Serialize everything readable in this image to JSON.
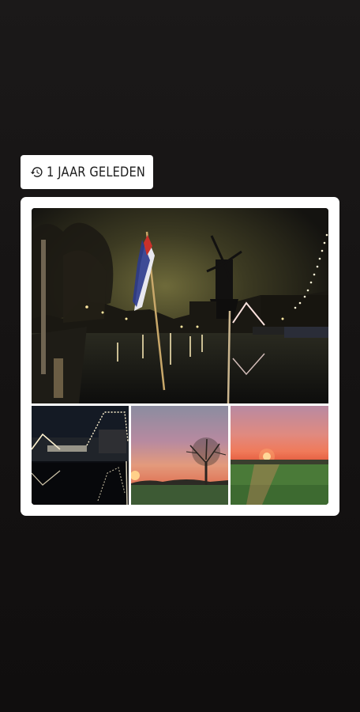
{
  "memory": {
    "label": "1 JAAR GELEDEN",
    "icon": "history-icon"
  },
  "collage": {
    "photos": [
      {
        "name": "photo-canal-windmill-night",
        "position": "main"
      },
      {
        "name": "photo-boat-lights-night",
        "position": "bottom-left"
      },
      {
        "name": "photo-tree-sunset",
        "position": "bottom-middle"
      },
      {
        "name": "photo-field-sunset",
        "position": "bottom-right"
      }
    ]
  },
  "colors": {
    "background": "#161414",
    "chip": "#ffffff",
    "card": "#ffffff",
    "text": "#1c1c1c"
  }
}
